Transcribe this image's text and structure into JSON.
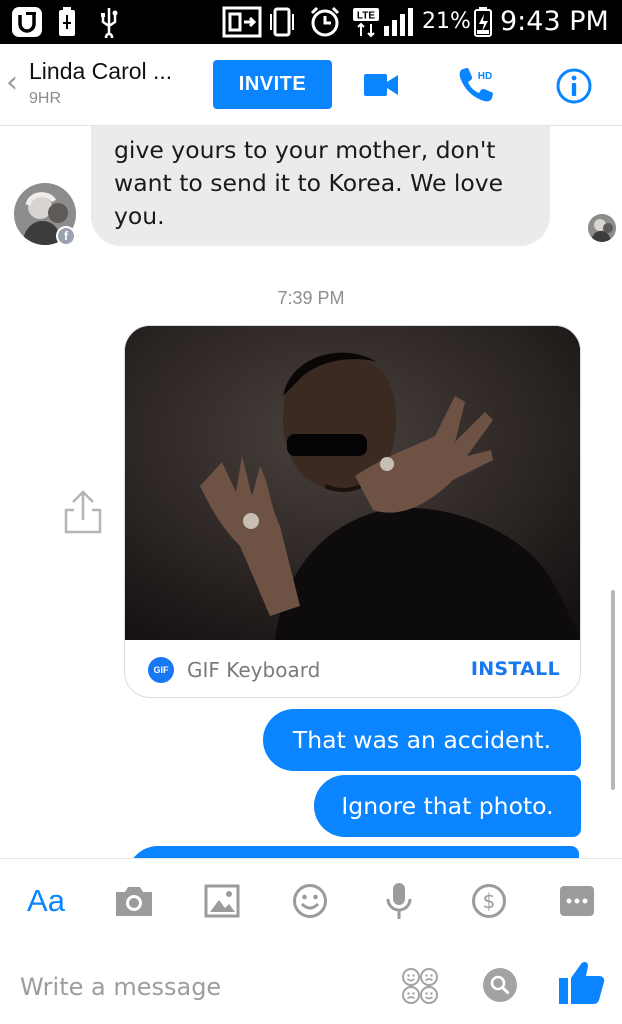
{
  "status_bar": {
    "battery_percent": "21%",
    "time": "9:43 PM",
    "network": "LTE",
    "icons": [
      "u-plus-icon",
      "battery-saver-icon",
      "usb-icon",
      "screen-mirror-icon",
      "vibrate-icon",
      "alarm-icon",
      "lte-icon",
      "signal-icon",
      "charging-battery-icon"
    ]
  },
  "header": {
    "contact_name": "Linda Carol ...",
    "active_status": "9HR",
    "invite_label": "INVITE",
    "icons": [
      "back-icon",
      "video-call-icon",
      "hd-call-icon",
      "info-icon"
    ],
    "accent_color": "#0a84ff"
  },
  "conversation": {
    "incoming_text_1": "give yours to your mother, don't",
    "incoming_text_2": "want to send it to Korea.  We love",
    "incoming_text_3": "you.",
    "timestamp": "7:39 PM",
    "gif_card": {
      "source_label": "GIF Keyboard",
      "logo_text": "GIF",
      "install_label": "INSTALL"
    },
    "outgoing_messages": [
      "That was an accident.",
      "Ignore that photo."
    ],
    "bubble_color": "#0a84ff",
    "incoming_bubble_color": "#ebebeb"
  },
  "composer": {
    "aa_label": "Aa",
    "placeholder": "Write a message",
    "icons": [
      "camera-icon",
      "gallery-icon",
      "emoji-icon",
      "microphone-icon",
      "payment-icon",
      "more-icon",
      "stickers-icon",
      "search-gif-icon",
      "like-icon"
    ]
  }
}
